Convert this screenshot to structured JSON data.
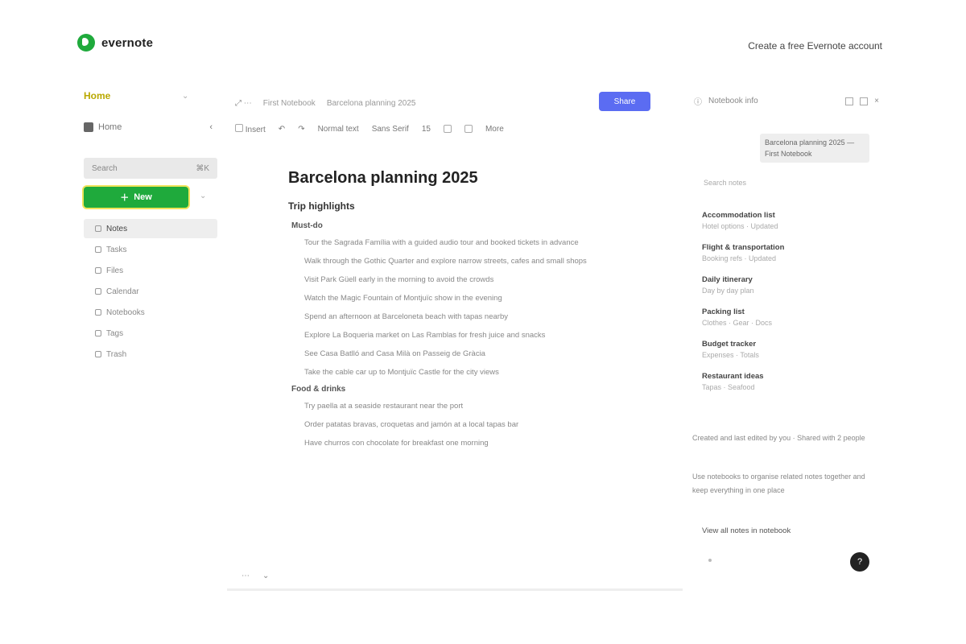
{
  "brand": {
    "name": "evernote"
  },
  "top": {
    "link": "Create a free Evernote account"
  },
  "sidebar": {
    "user": "Home",
    "user_chevron": "⌄",
    "home_label": "Home",
    "search_label": "Search",
    "search_shortcut": "⌘K",
    "new_label": "New",
    "new_more": "⌄",
    "nav": [
      {
        "label": "Notes",
        "active": true
      },
      {
        "label": "Tasks",
        "active": false
      },
      {
        "label": "Files",
        "active": false
      },
      {
        "label": "Calendar",
        "active": false
      },
      {
        "label": "Notebooks",
        "active": false
      },
      {
        "label": "Tags",
        "active": false
      },
      {
        "label": "Trash",
        "active": false
      }
    ]
  },
  "doc_header": {
    "icons": "⤢  ⋯",
    "notebook": "First Notebook",
    "breadcrumb": "Barcelona planning 2025",
    "share_label": "Share"
  },
  "format_bar": {
    "insert": "Insert",
    "undo": "↶",
    "redo": "↷",
    "style": "Normal text",
    "font": "Sans Serif",
    "size": "15",
    "more": "More"
  },
  "doc": {
    "title": "Barcelona planning 2025",
    "section": "Trip highlights",
    "subsection1": "Must-do",
    "list1": [
      "Tour the Sagrada Família with a guided audio tour and booked tickets in advance",
      "Walk through the Gothic Quarter and explore narrow streets, cafes and small shops",
      "Visit Park Güell early in the morning to avoid the crowds",
      "Watch the Magic Fountain of Montjuïc show in the evening",
      "Spend an afternoon at Barceloneta beach with tapas nearby",
      "Explore La Boqueria market on Las Ramblas for fresh juice and snacks",
      "See Casa Batlló and Casa Milà on Passeig de Gràcia",
      "Take the cable car up to Montjuïc Castle for the city views"
    ],
    "subsection2": "Food & drinks",
    "list2": [
      "Try paella at a seaside restaurant near the port",
      "Order patatas bravas, croquetas and jamón at a local tapas bar",
      "Have churros con chocolate for breakfast one morning"
    ]
  },
  "doc_bottom": {
    "left": "⋯",
    "right": "⌄"
  },
  "right_panel": {
    "header": "Notebook info",
    "tag": "Barcelona planning 2025 — First Notebook",
    "search": "Search notes",
    "items": [
      {
        "title": "Accommodation list",
        "sub": "Hotel options · Updated"
      },
      {
        "title": "Flight & transportation",
        "sub": "Booking refs · Updated"
      },
      {
        "title": "Daily itinerary",
        "sub": "Day by day plan"
      },
      {
        "title": "Packing list",
        "sub": "Clothes · Gear · Docs"
      },
      {
        "title": "Budget tracker",
        "sub": "Expenses · Totals"
      },
      {
        "title": "Restaurant ideas",
        "sub": "Tapas · Seafood"
      }
    ],
    "note1": "Created and last edited by you · Shared with 2 people",
    "note2": "Use notebooks to organise related notes together and keep everything in one place",
    "link": "View all notes in notebook",
    "help": "?"
  }
}
